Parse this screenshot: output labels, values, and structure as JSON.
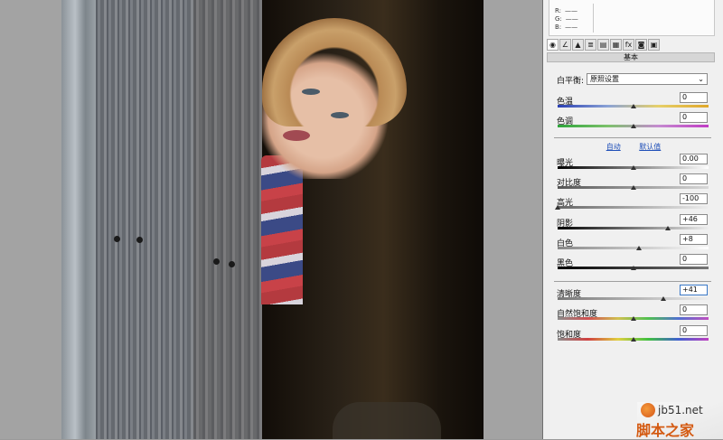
{
  "rgb_readout": [
    {
      "label": "R:",
      "value": "——"
    },
    {
      "label": "G:",
      "value": "——"
    },
    {
      "label": "B:",
      "value": "——"
    }
  ],
  "tabs": [
    {
      "icon": "aperture-icon"
    },
    {
      "icon": "tone-curve-icon"
    },
    {
      "icon": "detail-icon"
    },
    {
      "icon": "hsl-icon"
    },
    {
      "icon": "split-toning-icon"
    },
    {
      "icon": "lens-corrections-icon"
    },
    {
      "icon": "fx-icon",
      "glyph": "fx"
    },
    {
      "icon": "camera-calibration-icon"
    },
    {
      "icon": "presets-icon"
    }
  ],
  "panel_title": "基本",
  "white_balance": {
    "label": "白平衡:",
    "value": "原照设置"
  },
  "sliders": [
    {
      "key": "temperature",
      "label": "色温",
      "value": "0",
      "level": 0.5
    },
    {
      "key": "tint",
      "label": "色调",
      "value": "0",
      "level": 0.5
    },
    {
      "key": "exposure",
      "label": "曝光",
      "value": "0.00",
      "level": 0.5
    },
    {
      "key": "contrast",
      "label": "对比度",
      "value": "0",
      "level": 0.5
    },
    {
      "key": "highlights",
      "label": "高光",
      "value": "-100",
      "level": 0.0
    },
    {
      "key": "shadows",
      "label": "阴影",
      "value": "+46",
      "level": 0.73
    },
    {
      "key": "whites",
      "label": "白色",
      "value": "+8",
      "level": 0.54
    },
    {
      "key": "blacks",
      "label": "黑色",
      "value": "0",
      "level": 0.5
    },
    {
      "key": "clarity",
      "label": "清晰度",
      "value": "+41",
      "level": 0.7
    },
    {
      "key": "vibrance",
      "label": "自然饱和度",
      "value": "0",
      "level": 0.5
    },
    {
      "key": "saturation",
      "label": "饱和度",
      "value": "0",
      "level": 0.5
    }
  ],
  "links": {
    "auto": "自动",
    "default": "默认值"
  },
  "watermark": {
    "url": "jb51.net",
    "name": "脚本之家"
  }
}
